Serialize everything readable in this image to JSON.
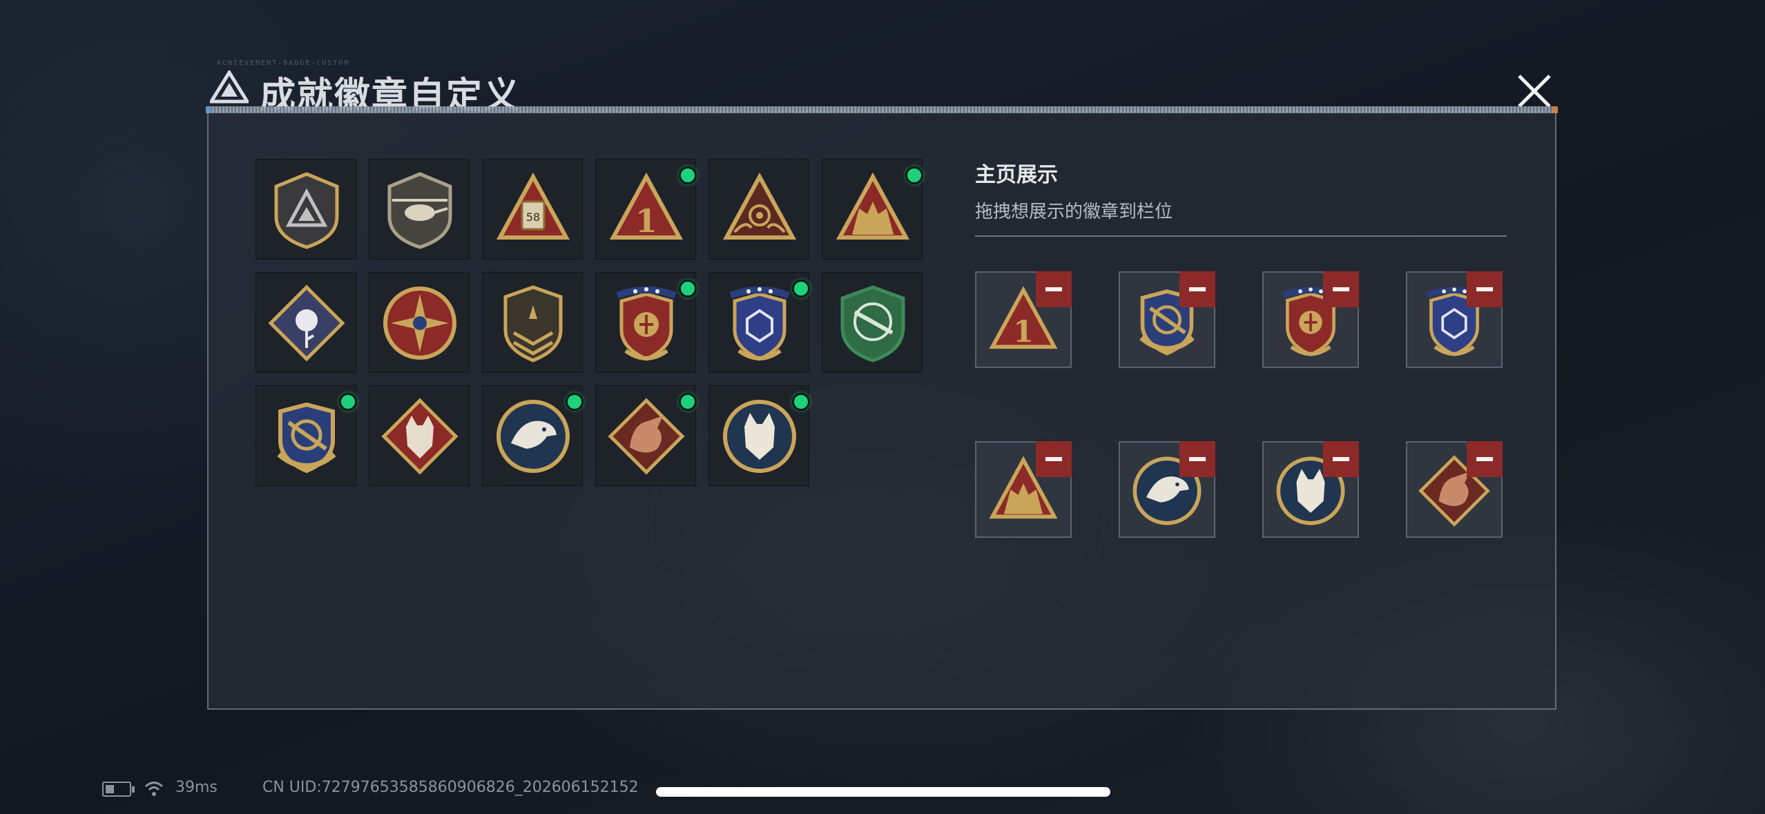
{
  "window": {
    "title": "成就徽章自定义",
    "title_tiny": "ACHIEVEMENT-BADGE-CUSTOM"
  },
  "colors": {
    "new_dot": "#1fd17a",
    "remove_button": "#8c2a2a",
    "panel_border": "#9aa6b4"
  },
  "icons": {
    "close": "close-icon",
    "remove": "minus-icon",
    "title_logo": "triangle-logo-icon"
  },
  "badges": [
    {
      "name": "shield-triangle-badge",
      "new": false
    },
    {
      "name": "helicopter-badge",
      "new": false
    },
    {
      "name": "radio-58-badge",
      "new": false,
      "label": "58"
    },
    {
      "name": "number-one-triangle-badge",
      "new": true,
      "label": "1"
    },
    {
      "name": "eye-hands-triangle-badge",
      "new": false
    },
    {
      "name": "soldiers-triangle-badge",
      "new": true
    },
    {
      "name": "rose-diamond-badge",
      "new": false
    },
    {
      "name": "compass-star-badge",
      "new": false
    },
    {
      "name": "chevron-shield-badge",
      "new": false
    },
    {
      "name": "red-crest-badge",
      "new": true
    },
    {
      "name": "blue-crest-badge",
      "new": true
    },
    {
      "name": "green-rifle-badge",
      "new": false
    },
    {
      "name": "gold-crest-rifle-badge",
      "new": true
    },
    {
      "name": "wolf-diamond-badge",
      "new": false
    },
    {
      "name": "eagle-round-badge",
      "new": true
    },
    {
      "name": "dragon-diamond-badge",
      "new": true
    },
    {
      "name": "lynx-round-badge",
      "new": true
    }
  ],
  "showcase": {
    "title": "主页展示",
    "subtitle": "拖拽想展示的徽章到栏位",
    "slots": [
      {
        "badge": "number-one-triangle-badge"
      },
      {
        "badge": "gold-crest-rifle-badge"
      },
      {
        "badge": "red-crest-badge"
      },
      {
        "badge": "blue-crest-badge"
      },
      {
        "badge": "soldiers-triangle-badge"
      },
      {
        "badge": "eagle-round-badge"
      },
      {
        "badge": "lynx-round-badge"
      },
      {
        "badge": "dragon-diamond-badge"
      }
    ]
  },
  "status": {
    "ping": "39ms",
    "uid": "CN UID:72797653585860906826_202606152152"
  }
}
